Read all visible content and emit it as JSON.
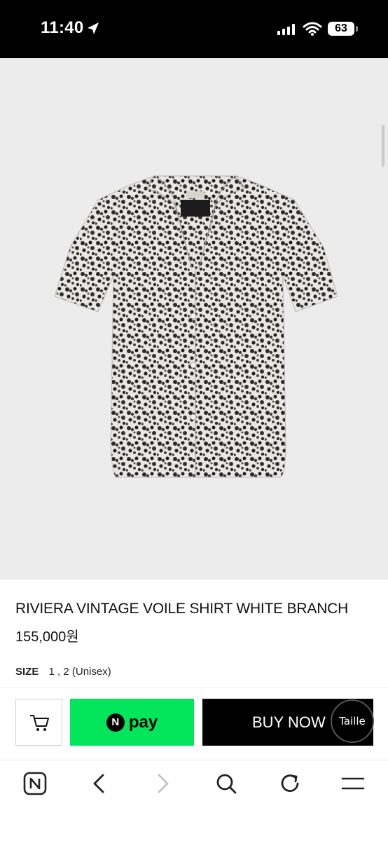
{
  "status_bar": {
    "time": "11:40",
    "battery": "63"
  },
  "product": {
    "name": "RIVIERA VINTAGE VOILE SHIRT WHITE BRANCH",
    "price": "155,000원",
    "size_label": "SIZE",
    "size_value": "1 , 2 (Unisex)",
    "image_label": "Taille"
  },
  "purchase_bar": {
    "npay_letter": "N",
    "npay_label": "pay",
    "buy_now_label": "BUY NOW",
    "taille_badge": "Taille"
  },
  "browser_toolbar": {
    "icons": [
      "naver-icon",
      "back-icon",
      "forward-icon",
      "search-icon",
      "refresh-icon",
      "menu-icon"
    ]
  },
  "colors": {
    "npay_green": "#03e55a",
    "buy_button": "#000000",
    "image_background": "#ececec"
  }
}
